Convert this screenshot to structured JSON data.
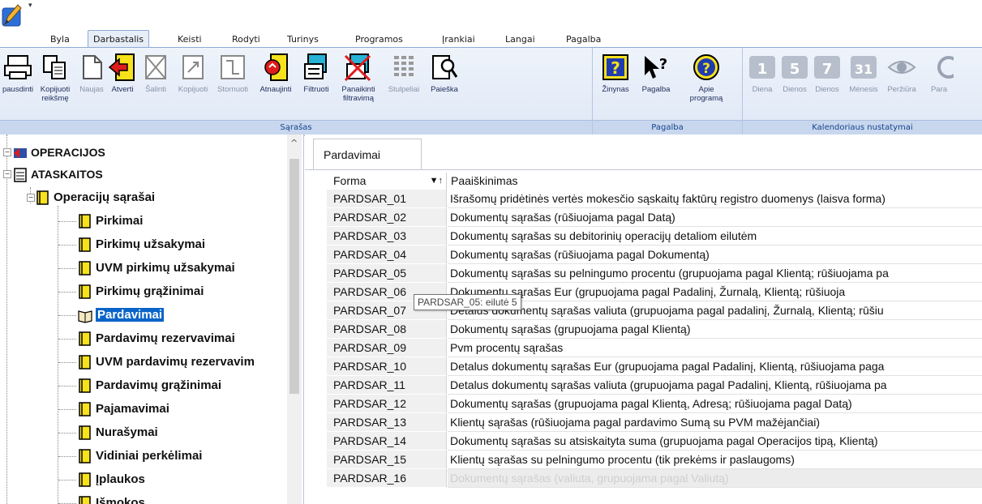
{
  "menu": {
    "tabs": [
      "Byla",
      "Darbastalis",
      "Keisti",
      "Rodyti",
      "Turinys",
      "Programos",
      "Įrankiai",
      "Langai",
      "Pagalba"
    ],
    "active_tab": "Darbastalis"
  },
  "ribbon": {
    "groups": [
      {
        "label": "Sąrašas"
      },
      {
        "label": "Pagalba"
      },
      {
        "label": "Kalendoriaus nustatymai"
      }
    ],
    "buttons": {
      "spausdinti": "pausdinti",
      "kopijuoti_reiksme": "Kopijuoti reikšmę",
      "naujas": "Naujas",
      "atverti": "Atverti",
      "salinti": "Šalinti",
      "kopijuoti": "Kopijuoti",
      "stornuoti": "Stornuoti",
      "atnaujinti": "Atnaujinti",
      "filtruoti": "Filtruoti",
      "panaikinti_filtravima": "Panaikinti filtravimą",
      "stulpeliai": "Stulpeliai",
      "paieska": "Paieška",
      "zinynas": "Žinynas",
      "pagalba": "Pagalba",
      "apie_programa": "Apie programą",
      "diena": "Diena",
      "dienos1": "Dienos",
      "dienos2": "Dienos",
      "menesis": "Mėnesis",
      "perziura": "Peržiūra",
      "para": "Para"
    },
    "calendar_digits": [
      "1",
      "5",
      "7",
      "31"
    ]
  },
  "tree": {
    "operacijos": "OPERACIJOS",
    "ataskaitos": "ATASKAITOS",
    "operaciju_sarasai": "Operacijų sąrašai",
    "items": [
      "Pirkimai",
      "Pirkimų užsakymai",
      "UVM pirkimų užsakymai",
      "Pirkimų grąžinimai",
      "Pardavimai",
      "Pardavimų rezervavimai",
      "UVM pardavimų rezervavim",
      "Pardavimų grąžinimai",
      "Pajamavimai",
      "Nurašymai",
      "Vidiniai perkėlimai",
      "Įplaukos",
      "Išmokos"
    ],
    "selected": "Pardavimai"
  },
  "content": {
    "tab": "Pardavimai",
    "columns": {
      "forma": "Forma",
      "paaiskinimas": "Paaiškinimas"
    },
    "sort_icon": "▼↑",
    "rows": [
      {
        "forma": "PARDSAR_01",
        "desc": "Išrašomų pridėtinės vertės mokesčio sąskaitų faktūrų registro duomenys (laisva forma)"
      },
      {
        "forma": "PARDSAR_02",
        "desc": "Dokumentų sąrašas (rūšiuojama pagal Datą)"
      },
      {
        "forma": "PARDSAR_03",
        "desc": "Dokumentų sąrašas su debitorinių operacijų detaliom eilutėm"
      },
      {
        "forma": "PARDSAR_04",
        "desc": "Dokumentų sąrašas (rūšiuojama pagal Dokumentą)"
      },
      {
        "forma": "PARDSAR_05",
        "desc": "Dokumentų sąrašas su pelningumo procentu (grupuojama pagal Klientą; rūšiuojama pa"
      },
      {
        "forma": "PARDSAR_06",
        "desc": "Dokumentų sąrašas Eur (grupuojama pagal Padalinį, Žurnalą, Klientą; rūšiuoja"
      },
      {
        "forma": "PARDSAR_07",
        "desc": "Detalus dokumentų sąrašas valiuta (grupuojama pagal padalinį, Žurnalą, Klientą; rūšiu"
      },
      {
        "forma": "PARDSAR_08",
        "desc": "Dokumentų sąrašas (grupuojama pagal Klientą)"
      },
      {
        "forma": "PARDSAR_09",
        "desc": "Pvm procentų sąrašas"
      },
      {
        "forma": "PARDSAR_10",
        "desc": "Detalus dokumentų sąrašas Eur (grupuojama pagal Padalinį, Klientą, rūšiuojama paga"
      },
      {
        "forma": "PARDSAR_11",
        "desc": "Detalus dokumentų sąrašas valiuta (grupuojama pagal Padalinį, Klientą, rūšiuojama pa"
      },
      {
        "forma": "PARDSAR_12",
        "desc": "Dokumentų sąrašas (grupuojama pagal Klientą, Adresą; rūšiuojama pagal Datą)"
      },
      {
        "forma": "PARDSAR_13",
        "desc": "Klientų sąrašas (rūšiuojama pagal pardavimo Sumą su PVM mažėjančiai)"
      },
      {
        "forma": "PARDSAR_14",
        "desc": "Dokumentų sąrašas su atsiskaityta suma (grupuojama pagal Operacijos tipą, Klientą)"
      },
      {
        "forma": "PARDSAR_15",
        "desc": "Klientų sąrašas su pelningumo procentu (tik prekėms ir paslaugoms)"
      },
      {
        "forma": "PARDSAR_16",
        "desc": "Dokumentų sąrašas (valiuta, grupuojama pagal Valiutą)"
      }
    ],
    "tooltip": "PARDSAR_05: eilutė 5"
  },
  "colors": {
    "ribbon_text": "#1e2c5a",
    "ribbon_group_label": "#15428b",
    "selection": "#0a64c8",
    "ribbon_bg": "#dfe8f6"
  },
  "icons": {
    "app": "edit-pencil-icon",
    "print": "printer-icon",
    "copy": "copy-icon",
    "new": "new-document-icon",
    "open": "open-arrow-icon",
    "delete": "delete-x-icon",
    "copy2": "copy-doc-icon",
    "cancel": "storno-icon",
    "refresh": "refresh-icon",
    "filter": "filter-icon",
    "remove_filter": "remove-filter-icon",
    "columns": "columns-icon",
    "search": "search-icon",
    "help_book": "help-book-icon",
    "help_pointer": "help-pointer-icon",
    "about": "about-icon",
    "calendar": "calendar-icon",
    "preview": "eye-icon"
  }
}
